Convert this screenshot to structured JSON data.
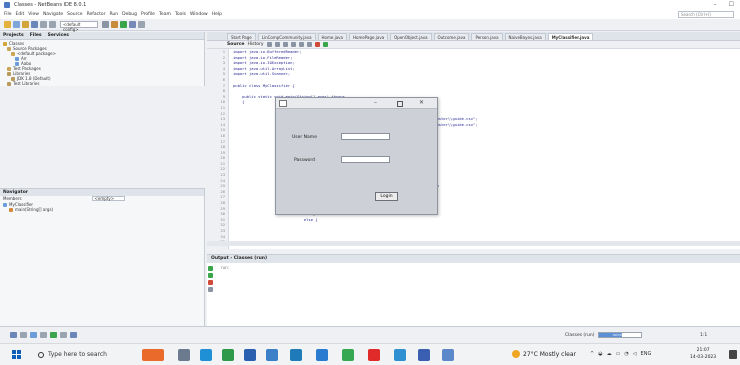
{
  "window": {
    "title": "Classes - NetBeans IDE 8.0.1"
  },
  "menubar": {
    "items": [
      "File",
      "Edit",
      "View",
      "Navigate",
      "Source",
      "Refactor",
      "Run",
      "Debug",
      "Profile",
      "Team",
      "Tools",
      "Window",
      "Help"
    ],
    "search_placeholder": "Search (Ctrl+I)"
  },
  "toolbar": {
    "config": "<default config>"
  },
  "projects": {
    "tabs": [
      "Projects",
      "Files",
      "Services"
    ],
    "tree": [
      {
        "label": "Classes",
        "indent": 1
      },
      {
        "label": "Source Packages",
        "indent": 2
      },
      {
        "label": "<default package>",
        "indent": 3
      },
      {
        "label": "Arr",
        "indent": 4
      },
      {
        "label": "Aabo",
        "indent": 4
      },
      {
        "label": "Test Packages",
        "indent": 2
      },
      {
        "label": "Libraries",
        "indent": 2
      },
      {
        "label": "JDK 1.8 (Default)",
        "indent": 3
      },
      {
        "label": "Test Libraries",
        "indent": 2
      }
    ]
  },
  "navigator": {
    "title": "Navigator",
    "members_label": "Members",
    "filter_value": "<empty>",
    "items": [
      {
        "label": "MyClassifier",
        "indent": 1
      },
      {
        "label": "main(String[] args)",
        "indent": 2
      }
    ]
  },
  "editor": {
    "tabs": [
      "Start Page",
      "LinCompCommunity.java",
      "Home.java",
      "HomePage.java",
      "OpenObject.java",
      "Outcome.java",
      "Person.java",
      "NaiveBayes.java",
      "MyClassifier.java"
    ],
    "active_tab": "MyClassifier.java",
    "subtabs": [
      "Source",
      "History"
    ],
    "line_numbers": [
      "1",
      "2",
      "3",
      "4",
      "5",
      "6",
      "7",
      "8",
      "9",
      "10",
      "11",
      "12",
      "13",
      "14",
      "15",
      "16",
      "17",
      "18",
      "19",
      "20",
      "21",
      "22",
      "23",
      "24",
      "25",
      "26",
      "27",
      "28",
      "29",
      "30",
      "31",
      "32",
      "33",
      "34",
      "35"
    ],
    "code": [
      "import java.io.BufferedReader;",
      "import java.io.FileReader;",
      "import java.io.IOException;",
      "import java.util.ArrayList;",
      "import java.util.Scanner;",
      "",
      "public class MyClassifier {",
      "",
      "    public static void main(String[] args) throws",
      "    {",
      "                                                        ();",
      "                                                        ();",
      "                                                       ilo-master\\\\character-classifier-master\\\\guide.csv\";",
      "                                                       ilo-master\\\\character-classifier-master\\\\guide.csv\";",
      "",
      "",
      "                                                       FileReader(trainingFile));",
      "",
      "                                                       o 10 fold cross-validation",
      "",
      "",
      "                                                       ead into 10 lines",
      "                                                       ileReader(trainingFile));",
      "                                                       == null) {",
      "                                                       rary 1 /case fold 1 as testing data",
      "                                                       ader.readLine()) != null) {",
      "                                   if(line.length() > 0) {",
      "                                       testing.add(new Person(line,0));",
      "",
      "                                   }",
      "                               else {"
    ]
  },
  "output": {
    "title": "Output - Classes (run)",
    "text": "run:"
  },
  "statusbar": {
    "run_label": "Classes (run)",
    "progress_label": "running...",
    "progress": 0.55,
    "caret": "1:1"
  },
  "dialog": {
    "username_label": "User Name",
    "password_label": "Password",
    "login_label": "Login"
  },
  "taskbar": {
    "search_placeholder": "Type here to search",
    "weather": "27°C  Mostly clear",
    "lang": "ENG",
    "time": "21:07",
    "date": "14-03-2023"
  }
}
